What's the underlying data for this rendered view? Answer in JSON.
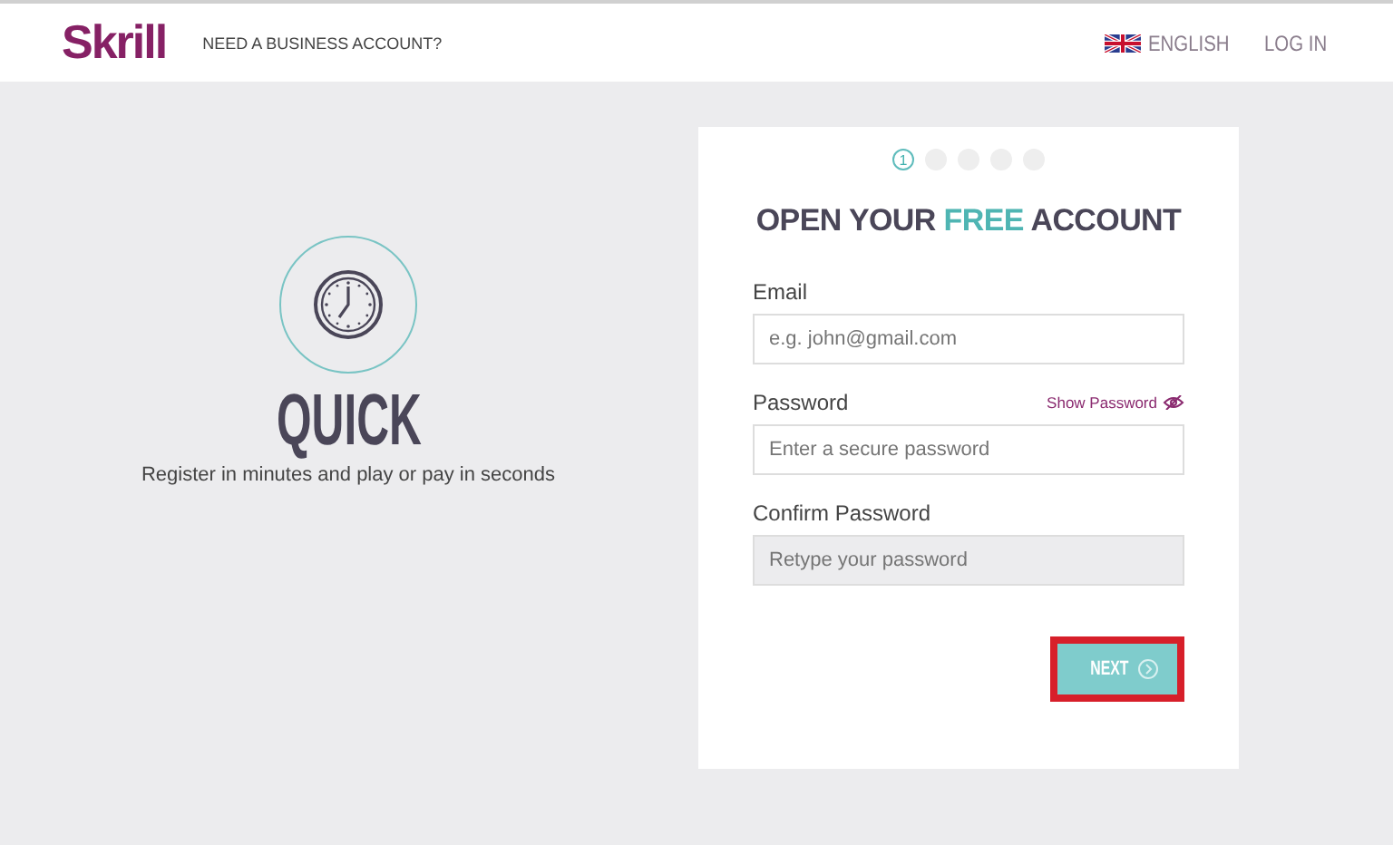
{
  "header": {
    "logo": "Skrill",
    "business_link": "NEED A BUSINESS ACCOUNT?",
    "language": "ENGLISH",
    "login": "LOG IN"
  },
  "feature": {
    "title": "QUICK",
    "subtitle": "Register in minutes and play or pay in seconds"
  },
  "form": {
    "steps": [
      {
        "label": "1",
        "selected": true
      },
      {
        "selected": false
      },
      {
        "selected": false
      },
      {
        "selected": false
      },
      {
        "selected": false
      }
    ],
    "title": [
      {
        "text": "OPEN YOUR ",
        "accent": false
      },
      {
        "text": "FREE",
        "accent": true
      },
      {
        "text": " ACCOUNT",
        "accent": false
      }
    ],
    "fields": [
      {
        "label": "Email",
        "placeholder": "e.g. john@gmail.com",
        "disabled": false
      },
      {
        "label": "Password",
        "placeholder": "Enter a secure password",
        "disabled": false,
        "toggle": "Show Password"
      },
      {
        "label": "Confirm Password",
        "placeholder": "Retype your password",
        "disabled": true
      }
    ],
    "next_button": {
      "label": "NEXT",
      "highlighted": true
    }
  }
}
